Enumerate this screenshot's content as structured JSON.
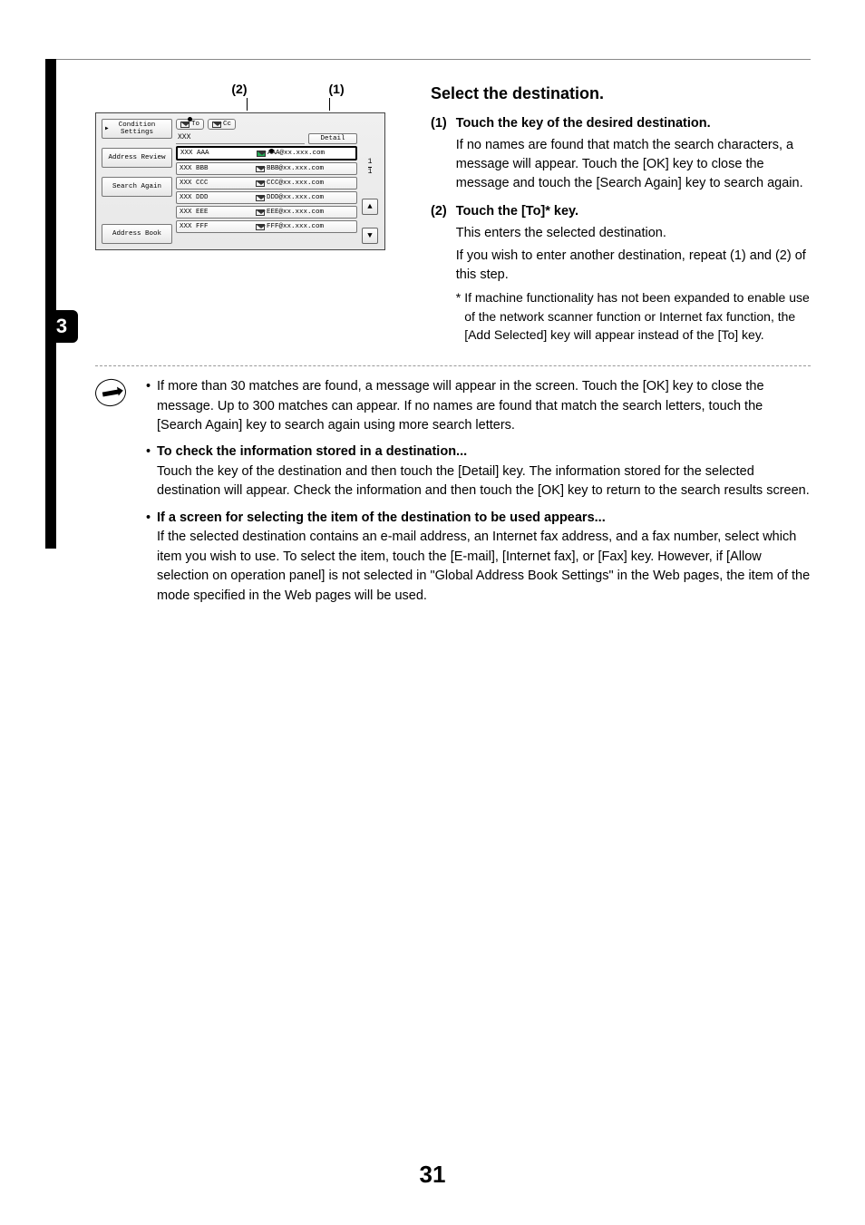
{
  "callouts": {
    "c2": "(2)",
    "c1": "(1)"
  },
  "screen": {
    "nav": {
      "condition": "Condition\nSettings",
      "review": "Address Review",
      "again": "Search Again",
      "book": "Address Book"
    },
    "tabs": {
      "to": "To",
      "cc": "Cc"
    },
    "search": {
      "text": "XXX",
      "detail": "Detail"
    },
    "rows": [
      {
        "name": "XXX AAA",
        "email": "AAA@xx.xxx.com"
      },
      {
        "name": "XXX BBB",
        "email": "BBB@xx.xxx.com"
      },
      {
        "name": "XXX CCC",
        "email": "CCC@xx.xxx.com"
      },
      {
        "name": "XXX DDD",
        "email": "DDD@xx.xxx.com"
      },
      {
        "name": "XXX EEE",
        "email": "EEE@xx.xxx.com"
      },
      {
        "name": "XXX FFF",
        "email": "FFF@xx.xxx.com"
      }
    ],
    "page": {
      "num": "1",
      "den": "1"
    }
  },
  "right": {
    "heading": "Select the destination.",
    "s1": {
      "num": "(1)",
      "title": "Touch the key of the desired destination.",
      "body": "If no names are found that match the search characters, a message will appear. Touch the [OK] key to close the message and touch the [Search Again] key to search again."
    },
    "s2": {
      "num": "(2)",
      "title": "Touch the [To]* key.",
      "l1": "This enters the selected destination.",
      "l2": "If you wish to enter another destination, repeat (1) and (2) of this step.",
      "fn_ast": "*",
      "fn": "If machine functionality has not been expanded to enable use of the network scanner function or Internet fax function, the [Add Selected] key will appear instead of the [To] key."
    }
  },
  "step": "3",
  "notes": {
    "b1": "If more than 30 matches are found, a message will appear in the screen. Touch the [OK] key to close the message. Up to 300 matches can appear. If no names are found that match the search letters, touch the [Search Again] key to search again using more search letters.",
    "b2t": "To check the information stored in a destination...",
    "b2": "Touch the key of the destination and then touch the [Detail] key. The information stored for the selected destination will appear. Check the information and then touch the [OK] key to return to the search results screen.",
    "b3t": "If a screen for selecting the item of the destination to be used appears...",
    "b3": "If the selected destination contains an e-mail address, an Internet fax address, and a fax number, select which item you wish to use. To select the item, touch the [E-mail], [Internet fax], or [Fax] key. However, if [Allow selection on operation panel] is not selected in \"Global Address Book Settings\" in the Web pages, the item of the mode specified in the Web pages will be used."
  },
  "pageNumber": "31"
}
